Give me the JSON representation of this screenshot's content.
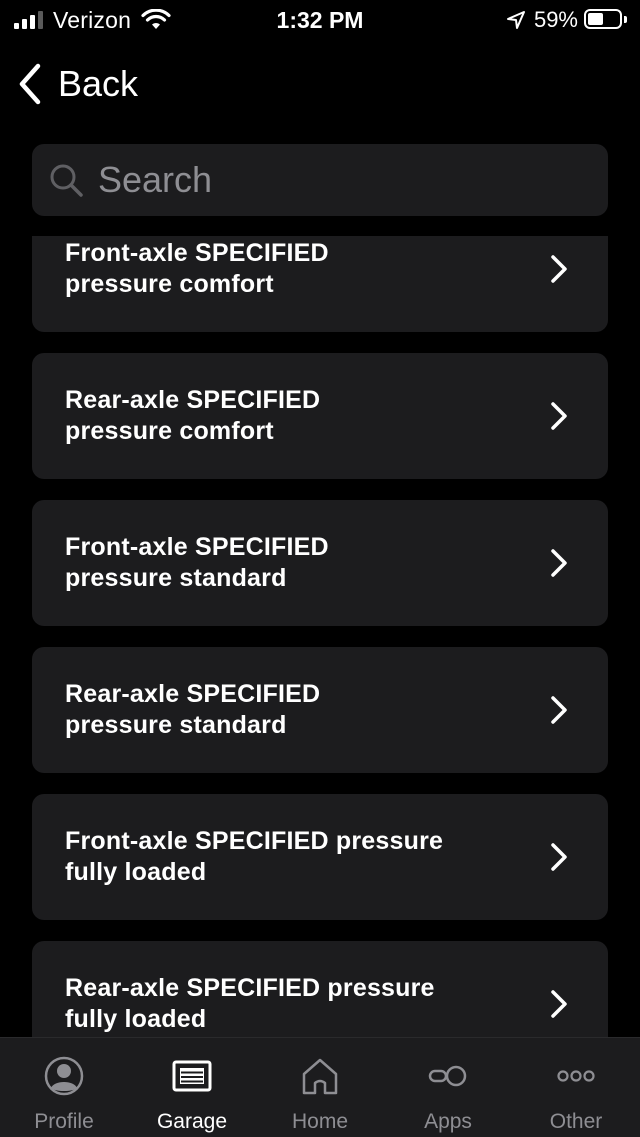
{
  "status_bar": {
    "carrier": "Verizon",
    "time": "1:32 PM",
    "battery_percent": "59%",
    "battery_level": 0.59,
    "signal_bars": 3,
    "signal_bars_total": 4
  },
  "nav": {
    "back_label": "Back"
  },
  "search": {
    "placeholder": "Search",
    "value": ""
  },
  "list": {
    "items": [
      {
        "label": "Front-axle SPECIFIED\npressure comfort"
      },
      {
        "label": "Rear-axle SPECIFIED\npressure comfort"
      },
      {
        "label": "Front-axle SPECIFIED\npressure standard"
      },
      {
        "label": "Rear-axle SPECIFIED\npressure standard"
      },
      {
        "label": "Front-axle SPECIFIED pressure\nfully loaded"
      },
      {
        "label": "Rear-axle SPECIFIED pressure\nfully loaded"
      }
    ]
  },
  "tab_bar": {
    "active": "Garage",
    "tabs": [
      {
        "label": "Profile",
        "icon": "profile-icon"
      },
      {
        "label": "Garage",
        "icon": "garage-icon"
      },
      {
        "label": "Home",
        "icon": "home-icon"
      },
      {
        "label": "Apps",
        "icon": "apps-icon"
      },
      {
        "label": "Other",
        "icon": "more-icon"
      }
    ]
  },
  "colors": {
    "background": "#000000",
    "card": "#1c1c1e",
    "inactive": "#8e8e93",
    "active": "#ffffff"
  }
}
